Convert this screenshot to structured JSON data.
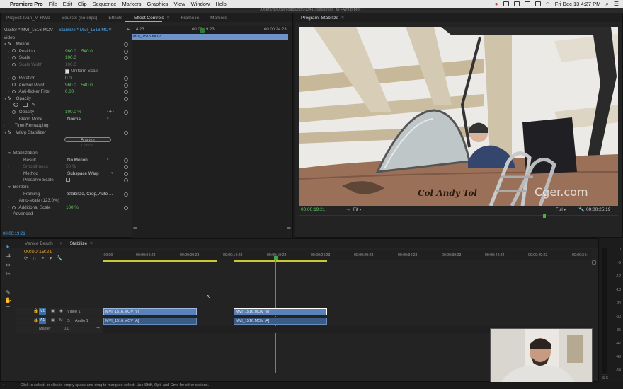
{
  "menubar": {
    "app_name": "Premiere Pro",
    "items": [
      "File",
      "Edit",
      "Clip",
      "Sequence",
      "Markers",
      "Graphics",
      "View",
      "Window",
      "Help"
    ],
    "clock": "Fri Dec 13  4:27 PM"
  },
  "window_path": "/Users/dt/Downloads/5df01341 36e6d/Ivan_M-HW9.prproj *",
  "left_tabs": [
    "Project: Ivan_M-HW9",
    "Source: (no clips)",
    "Effects",
    "Effect Controls",
    "Frame.io",
    "Markers"
  ],
  "effect_controls": {
    "master_label": "Master * MVI_1516.MOV",
    "sequence_label": "Stabilize * MVI_1516.MOV",
    "ruler": {
      "start": ":14:23",
      "mid": "00:00:19:23",
      "end": "00:00:24:23"
    },
    "clip_bar": "MVI_1516.MOV",
    "section_video": "Video",
    "motion": {
      "label": "Motion",
      "position": {
        "name": "Position",
        "x": "960.0",
        "y": "540.0"
      },
      "scale": {
        "name": "Scale",
        "value": "100.0"
      },
      "scale_width": {
        "name": "Scale Width",
        "value": "100.0"
      },
      "uniform": "Uniform Scale",
      "rotation": {
        "name": "Rotation",
        "value": "0.0"
      },
      "anchor": {
        "name": "Anchor Point",
        "x": "960.0",
        "y": "540.0"
      },
      "anti_flicker": {
        "name": "Anti-flicker Filter",
        "value": "0.00"
      }
    },
    "opacity": {
      "label": "Opacity",
      "opacity": {
        "name": "Opacity",
        "value": "100.0 %"
      },
      "blend": {
        "name": "Blend Mode",
        "value": "Normal"
      }
    },
    "time_remap": "Time Remapping",
    "warp": {
      "label": "Warp Stabilizer",
      "analyze_btn": "Analyze",
      "cancel_btn": "Cancel",
      "stabilization": "Stabilization",
      "result": {
        "name": "Result",
        "value": "No Motion"
      },
      "smoothness": {
        "name": "Smoothness",
        "value": "50 %"
      },
      "method": {
        "name": "Method",
        "value": "Subspace Warp"
      },
      "preserve": "Preserve Scale",
      "borders": "Borders",
      "framing": {
        "name": "Framing",
        "value": "Stabilize, Crop, Auto-..."
      },
      "autoscale": "Auto-scale (123.0%)",
      "additional_scale": {
        "name": "Additional Scale",
        "value": "100 %"
      },
      "advanced": "Advanced"
    },
    "footer_time": "00:00:19:21"
  },
  "program": {
    "tab": "Program: Stabilize",
    "timecode": "00:00:19:21",
    "fit": "Fit",
    "quality": "Full",
    "duration": "00:00:25:19",
    "jet_text": "Col Andy Tol",
    "watermark": "Cger.com"
  },
  "timeline": {
    "tabs": [
      "Venice Beach",
      "Stabilize"
    ],
    "timecode": "00:00:19:21",
    "ruler_ticks": [
      ":00:00",
      "00:00:04:23",
      "00:00:09:23",
      "00:00:14:23",
      "00:00:19:23",
      "00:00:24:23",
      "00:00:29:23",
      "00:00:34:23",
      "00:00:39:23",
      "00:00:44:22",
      "00:00:49:22",
      "00:00:54:"
    ],
    "tracks": {
      "v1": {
        "target": "V1",
        "name": "Video 1"
      },
      "a1": {
        "target": "A1",
        "name": "Audio 1"
      },
      "master": {
        "name": "Master",
        "value": "0.0"
      }
    },
    "clips": {
      "v1_a": "MVI_1516.MOV [V]",
      "v1_b": "MVI_1516.MOV [V]",
      "a1_a": "MVI_1516.MOV [A]",
      "a1_b": "MVI_1516.MOV [A]"
    }
  },
  "meters": [
    "0",
    "-6",
    "-12",
    "-18",
    "-24",
    "-30",
    "-36",
    "-42",
    "-48",
    "-54"
  ],
  "meter_footer": "S  S",
  "status_bar": "Click to select, or click in empty space and drag to marquee select. Use Shift, Opt, and Cmd for other options.",
  "colors": {
    "accent_blue": "#4aa3e8",
    "value_green": "#64c864",
    "clip_blue": "#5b82b8"
  }
}
